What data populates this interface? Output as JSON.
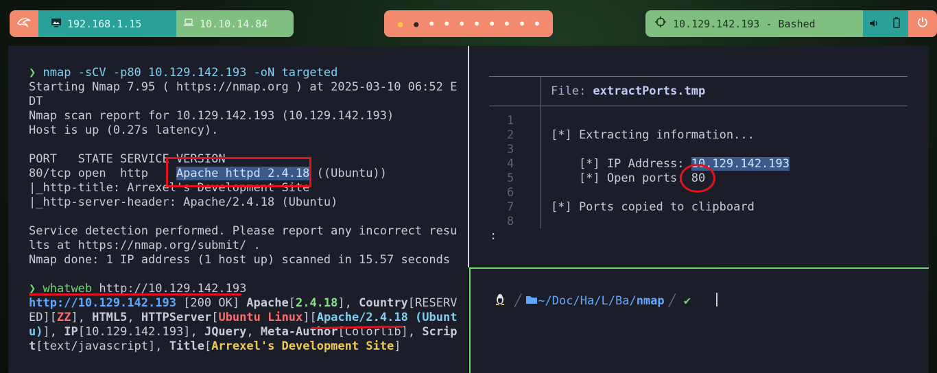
{
  "topbar": {
    "menu_icon": "kali-dragon-icon",
    "host_ip": "192.168.1.15",
    "vpn_ip": "10.10.14.84",
    "workspaces": [
      "●",
      "●",
      "●",
      "●",
      "●",
      "●",
      "●",
      "●",
      "●",
      "●"
    ],
    "target": "10.129.142.193 - Bashed",
    "colors": {
      "coral": "#f38a6e",
      "teal": "#2aa198",
      "green": "#7fbf7f"
    }
  },
  "left_terminal": {
    "lines": {
      "cmd1_prompt": "❯",
      "cmd1": "nmap -sCV -p80 10.129.142.193 -oN targeted",
      "l1": "Starting Nmap 7.95 ( https://nmap.org ) at 2025-03-10 06:52 E",
      "l2": "DT",
      "l3": "Nmap scan report for 10.129.142.193 (10.129.142.193)",
      "l4": "Host is up (0.27s latency).",
      "l5": "PORT   STATE SERVICE VERSION",
      "l6a": "80/tcp open  http    ",
      "l6b": "Apache httpd 2.4.18",
      "l6c": " ((Ubuntu))",
      "l7": "|_http-title: Arrexel's Development Site",
      "l8": "|_http-server-header: Apache/2.4.18 (Ubuntu)",
      "l9": "Service detection performed. Please report any incorrect resu",
      "l10": "lts at https://nmap.org/submit/ .",
      "l11": "Nmap done: 1 IP address (1 host up) scanned in 15.57 seconds",
      "cmd2_prompt": "❯",
      "cmd2_tool": "whatweb",
      "cmd2_arg": " http://10.129.142.193"
    },
    "whatweb": {
      "url": "http://10.129.142.193",
      "status": " [200 OK] ",
      "apache": "Apache",
      "apache_ver": "2.4.18",
      "country": "Country",
      "country_val1": "RESERV",
      "country_val2": "ED",
      "zz": "ZZ",
      "html5": "HTML5",
      "httpserver": "HTTPServer",
      "ubuntu_linux": "Ubuntu Linux",
      "apache_full1": "Apache/2.4.18 (Ubunt",
      "apache_full2": "u)",
      "ip": "IP",
      "ip_val": "10.129.142.193",
      "jquery": "JQuery",
      "metaauthor": "Meta-Author",
      "metaauthor_val": "Colorlib",
      "script1": "Scrip",
      "script2": "t",
      "script_val": "text/javascript",
      "title": "Title",
      "title_val": "Arrexel's Development Site"
    }
  },
  "file_view": {
    "file_label": "File: ",
    "file_name": "extractPorts.tmp",
    "line_numbers": [
      "1",
      "2",
      "3",
      "4",
      "5",
      "6",
      "7",
      "8"
    ],
    "line2": "[*] Extracting information...",
    "line4_label": "    [*] IP Address: ",
    "line4_val": "10.129.142.193",
    "line5_label": "    [*] Open ports: ",
    "line5_val": "80",
    "line7": "[*] Ports copied to clipboard",
    "pager": ":"
  },
  "prompt": {
    "tux": "🐧",
    "path_home": "~",
    "path_parts": [
      "Doc",
      "Ha",
      "L",
      "Ba"
    ],
    "path_last": "nmap",
    "status": "✔"
  }
}
